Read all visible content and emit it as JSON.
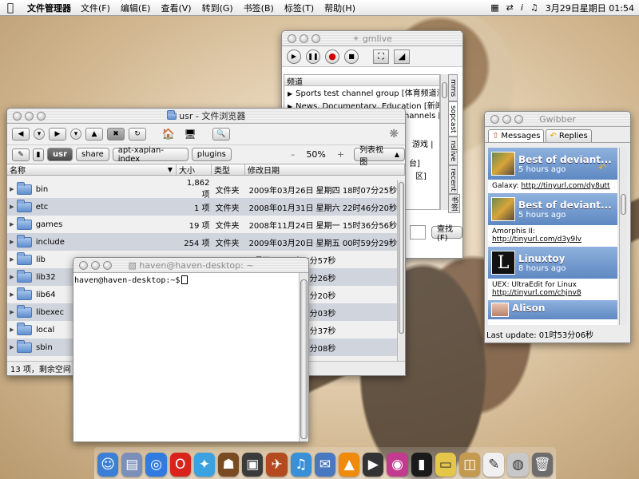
{
  "menubar": {
    "app_name": "文件管理器",
    "items": [
      "文件(F)",
      "编辑(E)",
      "查看(V)",
      "转到(G)",
      "书签(B)",
      "标签(T)",
      "帮助(H)"
    ],
    "clock": "3月29日星期日 01:54"
  },
  "gmlive": {
    "title": "gmlive",
    "list_header": "频道",
    "channels": [
      "Sports test channel group [体育频道测",
      "News, Documentary, Education [新闻纪",
      "hannels [",
      "游戏 |",
      "台]",
      "区]"
    ],
    "side_tabs": [
      "mms",
      "sopcast",
      "nslive",
      "recent",
      "书签"
    ],
    "search_label": "查找(F)"
  },
  "filebrowser": {
    "title": "usr - 文件浏览器",
    "path": [
      "usr",
      "share",
      "apt-xapian-index",
      "plugins"
    ],
    "zoom": "50%",
    "zoom_minus": "–",
    "zoom_plus": "+",
    "view_mode": "列表视图",
    "columns": [
      "名称",
      "大小",
      "类型",
      "修改日期"
    ],
    "rows": [
      {
        "name": "bin",
        "size": "1,862 项",
        "type": "文件夹",
        "date": "2009年03月26日 星期四 18时07分25秒"
      },
      {
        "name": "etc",
        "size": "1 项",
        "type": "文件夹",
        "date": "2008年01月31日 星期六 22时46分20秒"
      },
      {
        "name": "games",
        "size": "19 项",
        "type": "文件夹",
        "date": "2008年11月24日 星期一 15时36分56秒"
      },
      {
        "name": "include",
        "size": "254 项",
        "type": "文件夹",
        "date": "2009年03月20日 星期五 00时59分29秒"
      },
      {
        "name": "lib",
        "size": "",
        "type": "",
        "date": "星期四 18时06分57秒"
      },
      {
        "name": "lib32",
        "size": "",
        "type": "",
        "date": "星期一 12时17分26秒"
      },
      {
        "name": "lib64",
        "size": "",
        "type": "",
        "date": "星期一 12时17分20秒"
      },
      {
        "name": "libexec",
        "size": "",
        "type": "",
        "date": "星期二 19时53分03秒"
      },
      {
        "name": "local",
        "size": "",
        "type": "",
        "date": "星期三 23时16分37秒"
      },
      {
        "name": "sbin",
        "size": "",
        "type": "",
        "date": "星期四 18时07分08秒"
      }
    ],
    "status": "13 项，剩余空间"
  },
  "terminal": {
    "title": "haven@haven-desktop: ~",
    "prompt": "haven@haven-desktop:~$"
  },
  "gwibber": {
    "title": "Gwibber",
    "tabs": [
      "Messages",
      "Replies"
    ],
    "posts": [
      {
        "author": "Best of deviant...",
        "time": "5 hours ago",
        "text": "Galaxy: ",
        "link": "http://tinyurl.com/dy8utt"
      },
      {
        "author": "Best of deviant...",
        "time": "5 hours ago",
        "text": "Amorphis II:",
        "link": "http://tinyurl.com/d3y9lv"
      },
      {
        "author": "Linuxtoy",
        "time": "8 hours ago",
        "text": "UEX: UltraEdit for Linux",
        "link": "http://tinyurl.com/chjnv8"
      },
      {
        "author": "Alison",
        "time": "",
        "text": "",
        "link": ""
      }
    ],
    "linuxtoy_avatar": "L",
    "status": "Last update: 01时53分06秒"
  },
  "dock": {
    "icons": [
      "finder-icon",
      "files-icon",
      "safari-icon",
      "opera-icon",
      "twitter-bird-icon",
      "domo-icon",
      "photos-icon",
      "bird-icon",
      "itunes-icon",
      "mail-icon",
      "vlc-icon",
      "movie-icon",
      "photo-booth-icon",
      "terminal-icon",
      "stickies-icon",
      "package-icon",
      "textedit-icon",
      "dvd-icon",
      "trash-icon"
    ],
    "colors": [
      "#3d7fd6",
      "#7b8fb8",
      "#2f7be0",
      "#d9241c",
      "#3aa2e0",
      "#7a4a22",
      "#3b3b3b",
      "#b34b1f",
      "#3790d8",
      "#4a78c0",
      "#f08a0b",
      "#333333",
      "#c23b8f",
      "#1a1a1a",
      "#e4c64a",
      "#c49a4e",
      "#f0f0f0",
      "#c8c8c8",
      "#6d6d6d"
    ]
  }
}
